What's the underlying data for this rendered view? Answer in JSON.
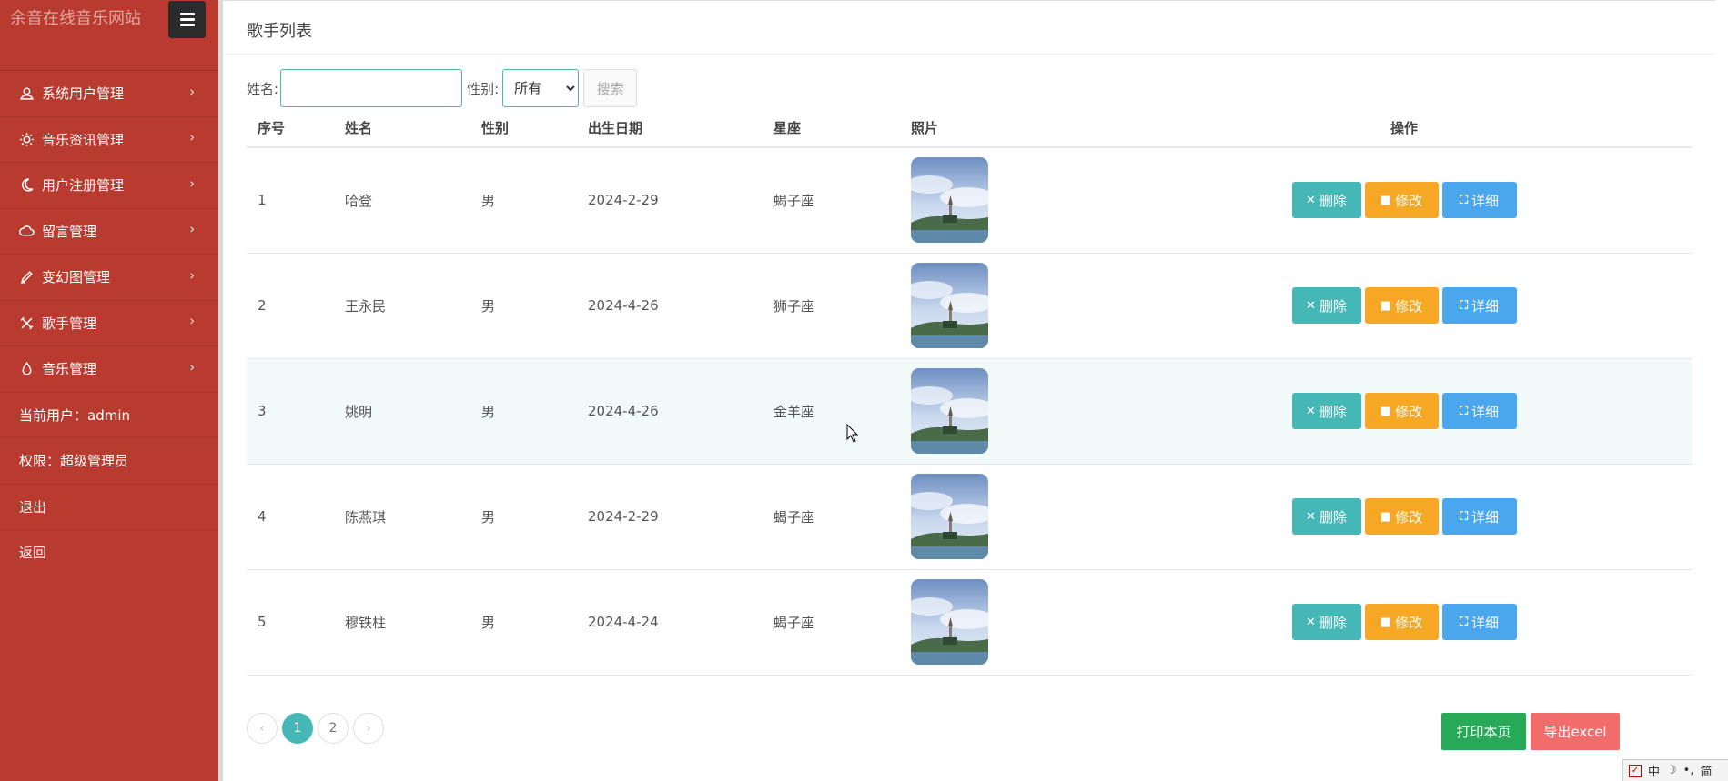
{
  "app": {
    "brand": "余音在线音乐网站"
  },
  "sidebar": {
    "items": [
      {
        "label": "系统用户管理",
        "icon": "user-icon"
      },
      {
        "label": "音乐资讯管理",
        "icon": "sun-icon"
      },
      {
        "label": "用户注册管理",
        "icon": "moon-icon"
      },
      {
        "label": "留言管理",
        "icon": "cloud-icon"
      },
      {
        "label": "变幻图管理",
        "icon": "pencil-icon"
      },
      {
        "label": "歌手管理",
        "icon": "tools-icon"
      },
      {
        "label": "音乐管理",
        "icon": "drop-icon"
      }
    ],
    "current_user": "当前用户：admin",
    "role": "权限：超级管理员",
    "logout": "退出",
    "back": "返回"
  },
  "panel": {
    "title": "歌手列表"
  },
  "search": {
    "name_label": "姓名:",
    "name_value": "",
    "sex_label": "性别:",
    "sex_selected": "所有",
    "search_button": "搜索"
  },
  "table": {
    "headers": [
      "序号",
      "姓名",
      "性别",
      "出生日期",
      "星座",
      "照片",
      "操作"
    ],
    "rows": [
      {
        "no": "1",
        "name": "哈登",
        "sex": "男",
        "birth": "2024-2-29",
        "zodiac": "蝎子座"
      },
      {
        "no": "2",
        "name": "王永民",
        "sex": "男",
        "birth": "2024-4-26",
        "zodiac": "狮子座"
      },
      {
        "no": "3",
        "name": "姚明",
        "sex": "男",
        "birth": "2024-4-26",
        "zodiac": "金羊座"
      },
      {
        "no": "4",
        "name": "陈燕琪",
        "sex": "男",
        "birth": "2024-2-29",
        "zodiac": "蝎子座"
      },
      {
        "no": "5",
        "name": "穆铁柱",
        "sex": "男",
        "birth": "2024-4-24",
        "zodiac": "蝎子座"
      }
    ],
    "actions": {
      "delete": "删除",
      "edit": "修改",
      "detail": "详细"
    }
  },
  "pagination": {
    "prev": "‹",
    "pages": [
      "1",
      "2"
    ],
    "current": "1",
    "next": "›"
  },
  "footer_buttons": {
    "print": "打印本页",
    "export": "导出excel"
  },
  "ime": {
    "lang": "中",
    "mode": "简"
  },
  "colors": {
    "sidebar": "#b93a2e",
    "delete": "#44b7b6",
    "edit": "#f6a825",
    "detail": "#4aa7ee",
    "print": "#27a957",
    "export": "#f26c6c"
  }
}
